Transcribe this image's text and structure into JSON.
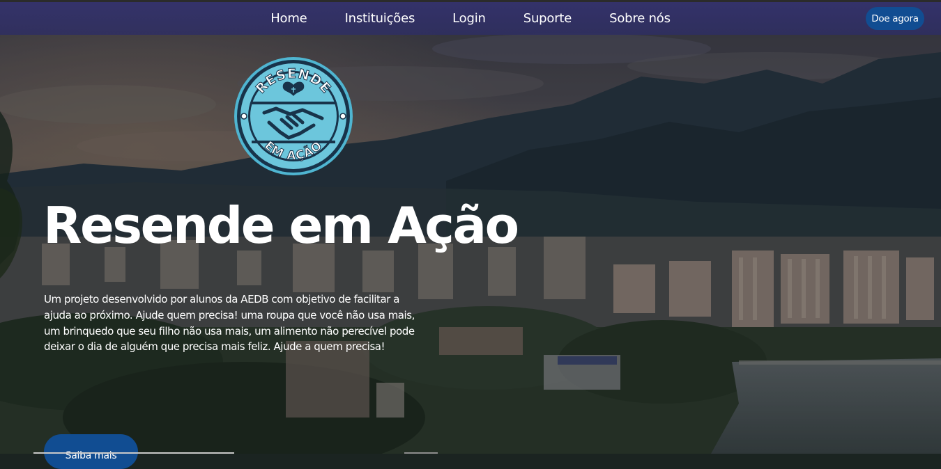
{
  "nav": {
    "links": [
      "Home",
      "Instituições",
      "Login",
      "Suporte",
      "Sobre nós"
    ],
    "donate_label": "Doe agora"
  },
  "logo": {
    "top_text": "RESENDE",
    "bottom_text": "EM AÇÃO"
  },
  "hero": {
    "title": "Resende em Ação",
    "description": "Um projeto desenvolvido por alunos da AEDB com objetivo de facilitar a ajuda ao próximo. Ajude quem precisa! uma roupa que você não usa mais, um brinquedo que seu filho não usa mais, um alimento não perecível pode deixar o dia de alguém que precisa mais feliz. Ajude a quem precisa!",
    "cta_label": "Saiba mais"
  },
  "colors": {
    "accent": "#114d92",
    "nav_bg": "#34326e",
    "logo_cyan": "#6cc6dc",
    "logo_ring": "#4fb5d1",
    "logo_dark": "#18334a"
  }
}
